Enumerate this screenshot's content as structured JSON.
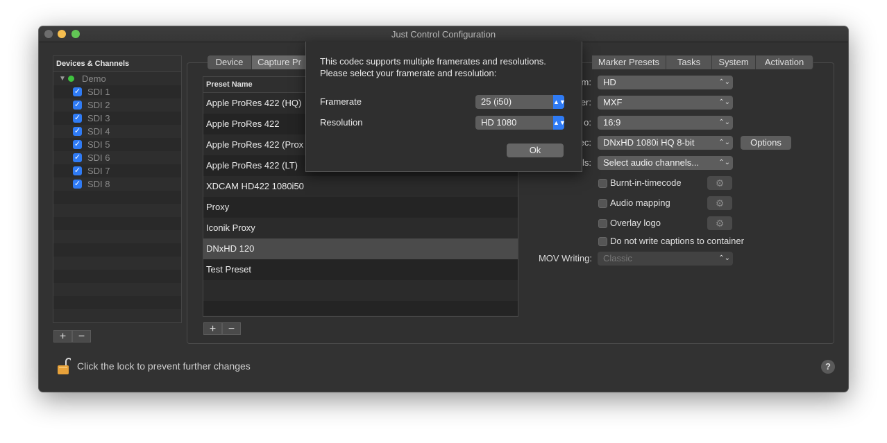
{
  "window": {
    "title": "Just Control Configuration"
  },
  "devices": {
    "header": "Devices & Channels",
    "group": "Demo",
    "channels": [
      "SDI 1",
      "SDI 2",
      "SDI 3",
      "SDI 4",
      "SDI 5",
      "SDI 6",
      "SDI 7",
      "SDI 8"
    ],
    "add": "+",
    "remove": "−"
  },
  "tabs": {
    "device": "Device",
    "capture": "Capture Pr",
    "marker": "Marker Presets",
    "tasks": "Tasks",
    "system": "System",
    "activation": "Activation"
  },
  "presets": {
    "header": "Preset Name",
    "items": [
      "Apple ProRes 422 (HQ)",
      "Apple ProRes 422",
      "Apple ProRes 422 (Prox",
      "Apple ProRes 422 (LT)",
      "XDCAM HD422 1080i50",
      "Proxy",
      "Iconik Proxy",
      "DNxHD 120",
      "Test Preset"
    ],
    "selected": "DNxHD 120",
    "add": "+",
    "remove": "−"
  },
  "settings": {
    "format_label": "m:",
    "format_value": "HD",
    "wrapper_label": "er:",
    "wrapper_value": "MXF",
    "aspect_label": "o:",
    "aspect_value": "16:9",
    "codec_label": "ec:",
    "codec_value": "DNxHD 1080i HQ 8-bit",
    "options_button": "Options",
    "audio_label": "ls:",
    "audio_value": "Select audio channels...",
    "burnt": "Burnt-in-timecode",
    "audio_mapping": "Audio mapping",
    "overlay": "Overlay logo",
    "captions": "Do not write captions to container",
    "mov_label": "MOV Writing:",
    "mov_value": "Classic"
  },
  "footer": {
    "lock_text": "Click the lock to prevent further changes",
    "help": "?"
  },
  "dialog": {
    "line1": "This codec supports multiple framerates and resolutions.",
    "line2": "Please select your framerate and resolution:",
    "framerate_label": "Framerate",
    "framerate_value": "25 (i50)",
    "resolution_label": "Resolution",
    "resolution_value": "HD 1080",
    "ok": "Ok"
  }
}
